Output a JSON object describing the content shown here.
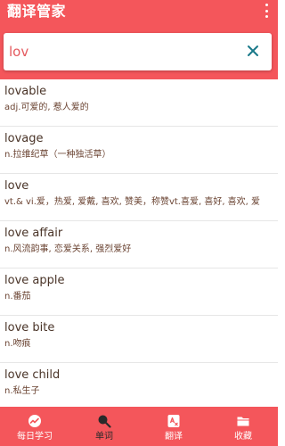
{
  "header": {
    "title": "翻译管家",
    "menu_icon": "more-vertical-icon"
  },
  "search": {
    "value": "lov",
    "placeholder": "",
    "clear_icon": "close-icon"
  },
  "results": [
    {
      "word": "lovable",
      "meaning": "adj.可爱的, 惹人爱的"
    },
    {
      "word": "lovage",
      "meaning": "n.拉维纪草（一种独活草）"
    },
    {
      "word": "love",
      "meaning": "vt.& vi.爱，热爱, 爱戴, 喜欢, 赞美，称赞vt.喜爱, 喜好, 喜欢, 爱"
    },
    {
      "word": "love affair",
      "meaning": "n.风流韵事, 恋爱关系, 强烈爱好"
    },
    {
      "word": "love apple",
      "meaning": "n.番茄"
    },
    {
      "word": "love bite",
      "meaning": "n.吻痕"
    },
    {
      "word": "love child",
      "meaning": "n.私生子"
    }
  ],
  "tabs": [
    {
      "label": "每日学习",
      "icon": "daily-study-icon",
      "active": false
    },
    {
      "label": "单词",
      "icon": "search-icon",
      "active": true
    },
    {
      "label": "翻译",
      "icon": "translate-icon",
      "active": false
    },
    {
      "label": "收藏",
      "icon": "folder-icon",
      "active": false
    }
  ],
  "colors": {
    "primary": "#f4565b",
    "word_text": "#4a3428",
    "active_tab_text": "#2a2a2a"
  }
}
